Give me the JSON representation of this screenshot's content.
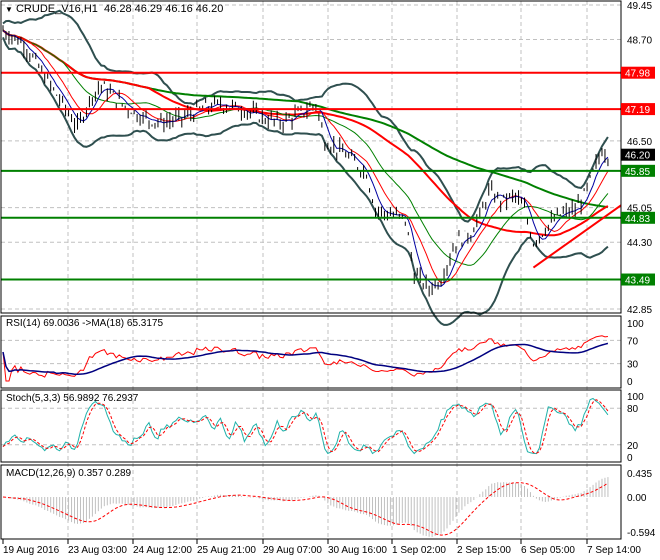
{
  "header": {
    "symbol": "CRUDE_V16,H1",
    "ohlc": "46.28 46.29 46.16 46.20"
  },
  "colors": {
    "up_down_bar": "#000000",
    "red_level": "#ff0000",
    "green_level": "#008000",
    "bands": "#2f4f4f",
    "ma_fast": "#0000a0",
    "rsi": "#ff0000",
    "rsi_ma": "#000080",
    "stoch_main": "#20b2aa",
    "stoch_signal": "#ff0000",
    "macd_hist": "#c0c0c0",
    "macd_signal": "#ff0000"
  },
  "chart_data": {
    "type": "line",
    "title": "CRUDE_V16,H1",
    "price_axis": {
      "ticks": [
        "49.45",
        "48.70",
        "46.50",
        "45.05",
        "44.30",
        "42.85"
      ],
      "ylim": [
        42.85,
        49.45
      ]
    },
    "current_price": "46.20",
    "levels": [
      {
        "value": 47.98,
        "label": "47.98",
        "color": "red"
      },
      {
        "value": 47.19,
        "label": "47.19",
        "color": "red"
      },
      {
        "value": 45.85,
        "label": "45.85",
        "color": "green"
      },
      {
        "value": 44.83,
        "label": "44.83",
        "color": "green"
      },
      {
        "value": 43.49,
        "label": "43.49",
        "color": "green"
      }
    ],
    "trendline": {
      "from": [
        178,
        43.75
      ],
      "to": [
        206,
        45.1
      ]
    },
    "price_keypoints": [
      [
        0,
        48.9
      ],
      [
        7,
        48.6
      ],
      [
        13,
        48.0
      ],
      [
        20,
        47.3
      ],
      [
        25,
        46.8
      ],
      [
        30,
        47.5
      ],
      [
        33,
        47.7
      ],
      [
        40,
        47.3
      ],
      [
        47,
        47.0
      ],
      [
        53,
        46.9
      ],
      [
        60,
        47.0
      ],
      [
        67,
        47.2
      ],
      [
        73,
        47.3
      ],
      [
        80,
        47.2
      ],
      [
        87,
        47.0
      ],
      [
        93,
        46.9
      ],
      [
        100,
        47.1
      ],
      [
        105,
        47.3
      ],
      [
        108,
        46.5
      ],
      [
        115,
        46.2
      ],
      [
        122,
        45.8
      ],
      [
        125,
        45.0
      ],
      [
        130,
        44.9
      ],
      [
        135,
        44.8
      ],
      [
        138,
        43.6
      ],
      [
        143,
        43.3
      ],
      [
        147,
        43.5
      ],
      [
        152,
        44.3
      ],
      [
        157,
        44.5
      ],
      [
        161,
        45.0
      ],
      [
        163,
        45.4
      ],
      [
        167,
        45.2
      ],
      [
        172,
        45.3
      ],
      [
        175,
        45.0
      ],
      [
        178,
        44.3
      ],
      [
        182,
        44.6
      ],
      [
        187,
        44.9
      ],
      [
        192,
        45.0
      ],
      [
        195,
        45.3
      ],
      [
        198,
        45.8
      ],
      [
        201,
        46.3
      ],
      [
        203,
        46.2
      ]
    ],
    "time_axis": [
      "19 Aug 2016",
      "23 Aug 03:00",
      "24 Aug 12:00",
      "25 Aug 21:00",
      "29 Aug 07:00",
      "30 Aug 16:00",
      "1 Sep 02:00",
      "2 Sep 15:00",
      "6 Sep 05:00",
      "7 Sep 14:00"
    ],
    "rsi": {
      "label": "RSI(14) 69.0036  ->MA(18) 65.3175",
      "ticks": [
        "100",
        "70",
        "30",
        "0"
      ]
    },
    "stoch": {
      "label": "Stoch(5,3,3) 56.9892 76.2937",
      "ticks": [
        "100",
        "80",
        "20",
        "0"
      ]
    },
    "macd": {
      "label": "MACD(12,26,9) 0.357 0.289",
      "ticks": [
        "0.435",
        "0.00",
        "-0.594"
      ]
    }
  }
}
